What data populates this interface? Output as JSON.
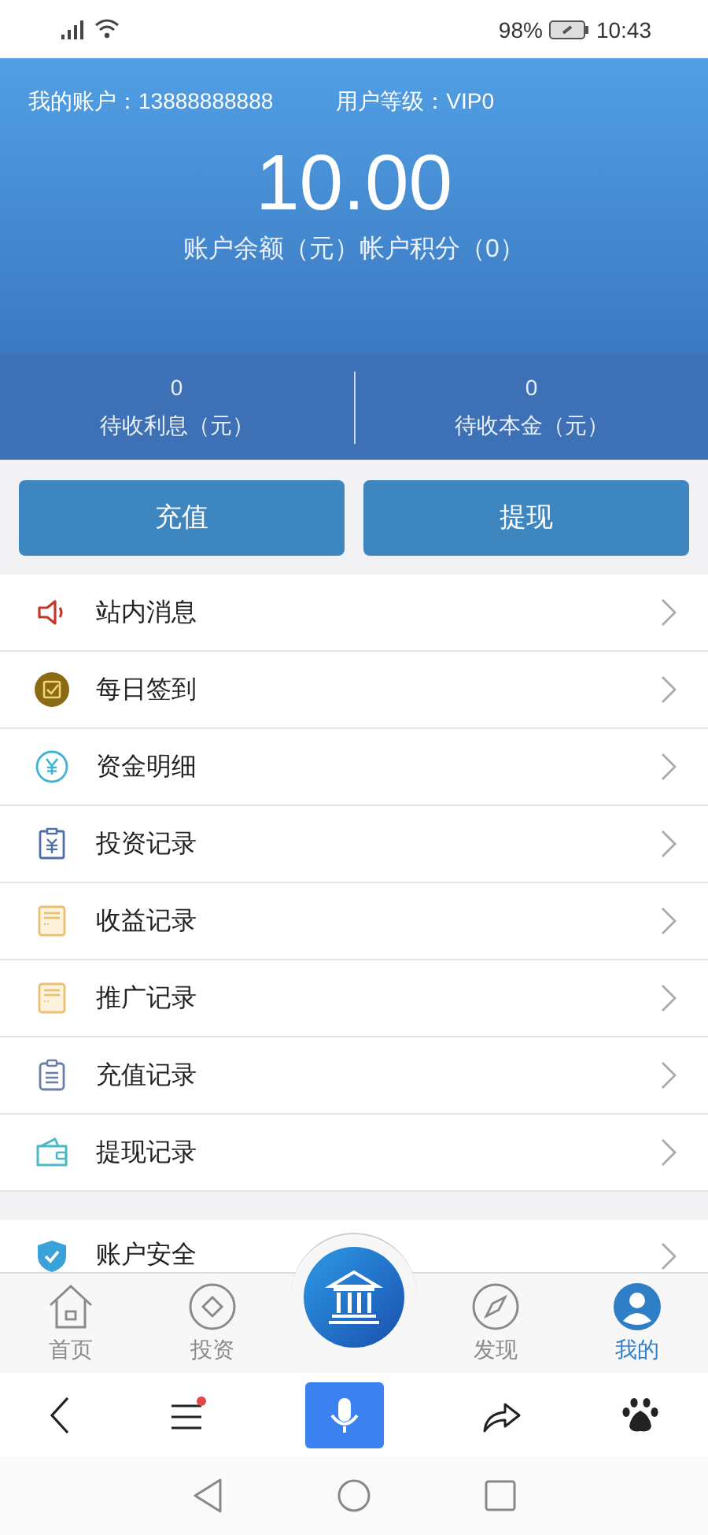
{
  "status_bar": {
    "battery": "98%",
    "time": "10:43"
  },
  "account": {
    "account_label": "我的账户：13888888888",
    "level_label": "用户等级：VIP0",
    "balance": "10.00",
    "balance_caption": "账户余额（元）帐户积分（0）"
  },
  "stats": [
    {
      "value": "0",
      "label": "待收利息（元）"
    },
    {
      "value": "0",
      "label": "待收本金（元）"
    }
  ],
  "actions": [
    "充值",
    "提现"
  ],
  "menu": [
    {
      "label": "站内消息"
    },
    {
      "label": "每日签到"
    },
    {
      "label": "资金明细"
    },
    {
      "label": "投资记录"
    },
    {
      "label": "收益记录"
    },
    {
      "label": "推广记录"
    },
    {
      "label": "充值记录"
    },
    {
      "label": "提现记录"
    }
  ],
  "menu_2": [
    {
      "label": "账户安全"
    }
  ],
  "tab_bar": [
    {
      "label": "首页",
      "selected": false
    },
    {
      "label": "投资",
      "selected": false
    },
    {
      "label": "发现",
      "selected": false
    },
    {
      "label": "我的",
      "selected": true
    }
  ]
}
